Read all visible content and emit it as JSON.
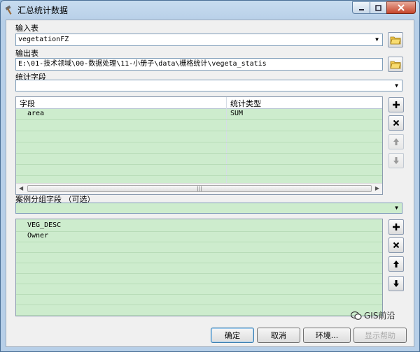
{
  "window": {
    "title": "汇总统计数据"
  },
  "input_table": {
    "label": "输入表",
    "value": "vegetationFZ"
  },
  "output_table": {
    "label": "输出表",
    "value": "E:\\01-技术领域\\00-数据处理\\11-小册子\\data\\栅格统计\\vegeta_statis"
  },
  "stat_fields": {
    "label": "统计字段",
    "value": "",
    "columns": [
      "字段",
      "统计类型"
    ],
    "rows": [
      [
        "area",
        "SUM"
      ]
    ]
  },
  "case_fields": {
    "label": "案例分组字段 （可选）",
    "value": "",
    "items": [
      "VEG_DESC",
      "Owner"
    ]
  },
  "buttons": {
    "ok": "确定",
    "cancel": "取消",
    "env": "环境...",
    "show_help": "显示帮助"
  },
  "watermark": {
    "text": "GIS前沿"
  }
}
